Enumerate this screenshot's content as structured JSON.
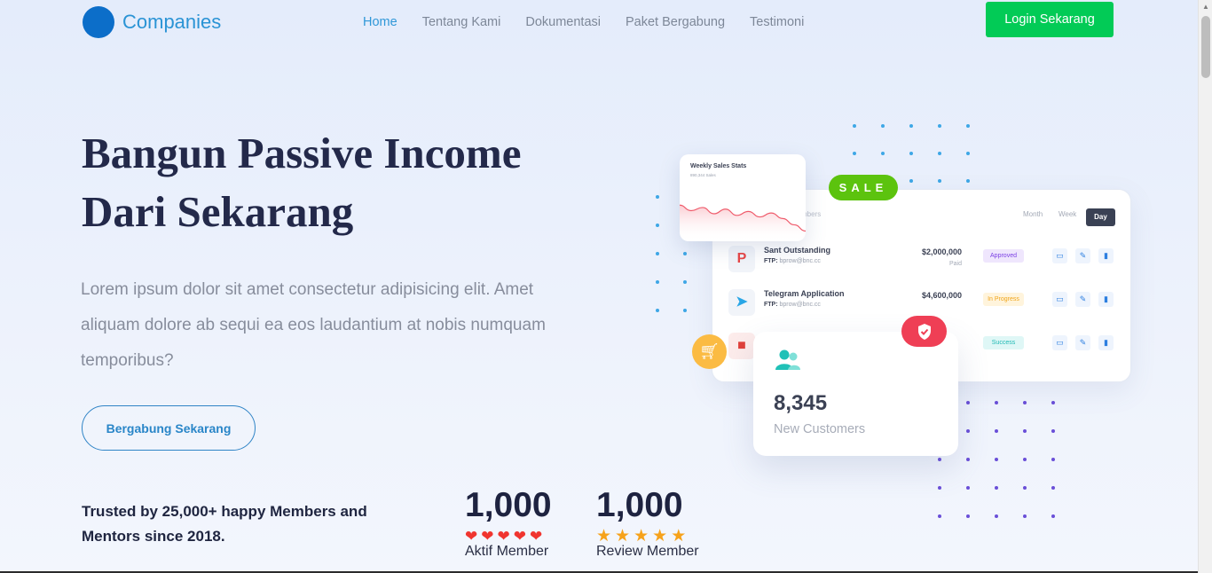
{
  "header": {
    "brand": "Companies",
    "nav": [
      "Home",
      "Tentang Kami",
      "Dokumentasi",
      "Paket Bergabung",
      "Testimoni"
    ],
    "active_nav": "Home",
    "login_label": "Login Sekarang"
  },
  "hero": {
    "title_line1": "Bangun Passive Income",
    "title_line2": "Dari Sekarang",
    "description": "Lorem ipsum dolor sit amet consectetur adipisicing elit. Amet aliquam dolore ab sequi ea eos laudantium at nobis numquam temporibus?",
    "cta_label": "Bergabung Sekarang",
    "trusted_text": "Trusted by 25,000+ happy Members and Mentors since 2018."
  },
  "stats": [
    {
      "value": "1,000",
      "label": "Aktif Member",
      "icon": "heart-icon",
      "rating": 5
    },
    {
      "value": "1,000",
      "label": "Review Member",
      "icon": "star-icon",
      "rating": 5
    }
  ],
  "illustration": {
    "sale_label": "SALE",
    "chart_title": "Weekly Sales Stats",
    "chart_subtitle": "890,344 Sales",
    "periods": [
      "Month",
      "Week",
      "Day"
    ],
    "active_period": "Day",
    "partial_header": "mbers",
    "rows": [
      {
        "name": "Sant Outstanding",
        "sub_key": "FTP:",
        "sub": "bprow@bnc.cc",
        "amount": "$2,000,000",
        "paid": "Paid",
        "status": "Approved",
        "status_color": "#7b3fe4",
        "status_bg": "#efe6fd",
        "icon": "P"
      },
      {
        "name": "Telegram Application",
        "sub_key": "FTP:",
        "sub": "bprow@bnc.cc",
        "amount": "$4,600,000",
        "paid": "",
        "status": "In Progress",
        "status_color": "#f0a51b",
        "status_bg": "#fff4dc",
        "icon": "➤"
      },
      {
        "name": "",
        "sub_key": "",
        "sub": "",
        "amount": "",
        "paid": "",
        "status": "Success",
        "status_color": "#1fb9b4",
        "status_bg": "#dff7f6",
        "icon": ""
      }
    ],
    "customers_value": "8,345",
    "customers_label": "New Customers",
    "colors": {
      "sale": "#5cc30e",
      "shield": "#ef3f55",
      "cart": "#fbbb43",
      "chart_line": "#ef5b6b"
    },
    "chart_series": [
      55,
      48,
      52,
      44,
      50,
      42,
      47,
      40,
      45,
      38,
      30,
      22
    ]
  }
}
